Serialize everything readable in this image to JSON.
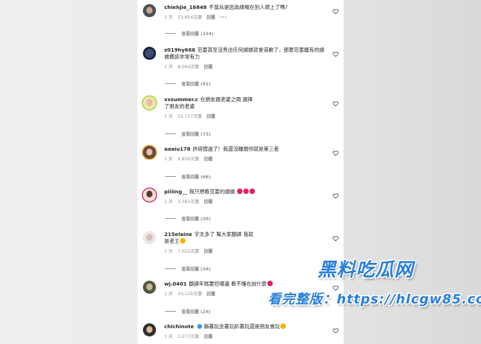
{
  "comments": [
    {
      "username": "chiehjie_16848",
      "text": "不當兵是因為綠帽在別人頭上了嗎?",
      "time": "1 天",
      "likes": "23,854次讚",
      "reply_label": "回覆",
      "more": "···",
      "view_replies": "查看回覆 (234)"
    },
    {
      "username": "z019hy666",
      "text": "范姜甚至沒秀出任何證據就會道歉了，那麼范姜握有的證據應該非常有力",
      "time": "1 天",
      "likes": "8,584次讚",
      "reply_label": "回覆",
      "view_replies": "查看回覆 (61)"
    },
    {
      "username": "xxsummer.c",
      "text": "在朋友跟老婆之間 選擇了朋友的老婆",
      "time": "1 天",
      "likes": "15,727次讚",
      "reply_label": "回覆",
      "view_replies": "查看回覆 (73)"
    },
    {
      "username": "aaaiu178",
      "text": "許研撐過了！我還沒離婚你就是第三者",
      "time": "1 天",
      "likes": "9,856次讚",
      "reply_label": "回覆",
      "view_replies": "查看回覆 (66)"
    },
    {
      "username": "piiiing__",
      "text": "我只想看范姜的證據",
      "time": "1 天",
      "likes": "3,583次讚",
      "reply_label": "回覆",
      "view_replies": "查看回覆 (29)"
    },
    {
      "username": "215elaine",
      "text": "字太多了 幫大家翻譯 我就是老王",
      "time": "1 天",
      "likes": "7,022次讚",
      "reply_label": "回覆",
      "view_replies": "查看回覆 (24)"
    },
    {
      "username": "wj.0401",
      "text": "翻譯年糕要控哪邊 看不懂在說什麼",
      "time": "1 天",
      "likes": "10,128次讚",
      "reply_label": "回覆",
      "view_replies": "查看回覆 (24)"
    },
    {
      "username": "chichinote",
      "text": "躺著玩坐著玩趴著玩還是朋友會玩",
      "time": "1 天",
      "likes": "3,277次讚",
      "reply_label": "回覆"
    }
  ],
  "watermark": {
    "line1": "黑料吃瓜网",
    "line2": "看完整版：https://hlcgw85.com"
  },
  "colors": {
    "ring_pink": "#d62976",
    "muted": "#8e8e8e",
    "text": "#262626",
    "watermark_blue": "#2a7fd9"
  }
}
